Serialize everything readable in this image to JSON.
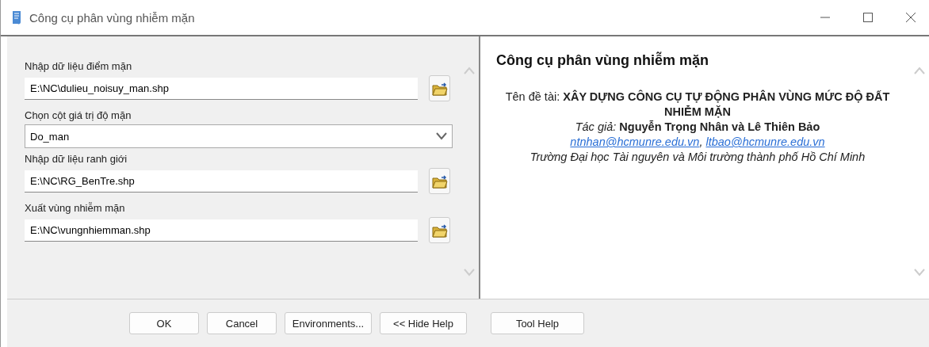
{
  "window": {
    "title": "Công cụ phân vùng nhiễm mặn"
  },
  "parameters": [
    {
      "kind": "file",
      "label": "Nhập dữ liệu điểm mặn",
      "value": "E:\\NC\\dulieu_noisuy_man.shp"
    },
    {
      "kind": "dropdown",
      "label": "Chọn cột giá trị độ mặn",
      "value": "Do_man"
    },
    {
      "kind": "file",
      "label": "Nhập dữ liệu ranh giới",
      "value": "E:\\NC\\RG_BenTre.shp"
    },
    {
      "kind": "file",
      "label": "Xuất vùng nhiễm mặn",
      "value": "E:\\NC\\vungnhiemman.shp"
    }
  ],
  "help": {
    "title": "Công cụ phân vùng nhiễm mặn",
    "topic": "Tên đề tài: **XÂY DỰNG CÔNG CỤ TỰ ĐỘNG PHÂN VÙNG MỨC ĐỘ ĐẤT NHIỄM MẶN**",
    "authors": "*Tác giả:* **Nguyễn Trọng Nhân và Lê Thiên Bảo**",
    "emails": [
      "ntnhan@hcmunre.edu.vn",
      "ltbao@hcmunre.edu.vn"
    ],
    "email_separator": ",",
    "institution": "Trường Đại học Tài nguyên và Môi trường thành phố Hồ Chí Minh"
  },
  "buttons": [
    "OK",
    "Cancel",
    "Environments...",
    "<< Hide Help",
    "Tool Help"
  ]
}
